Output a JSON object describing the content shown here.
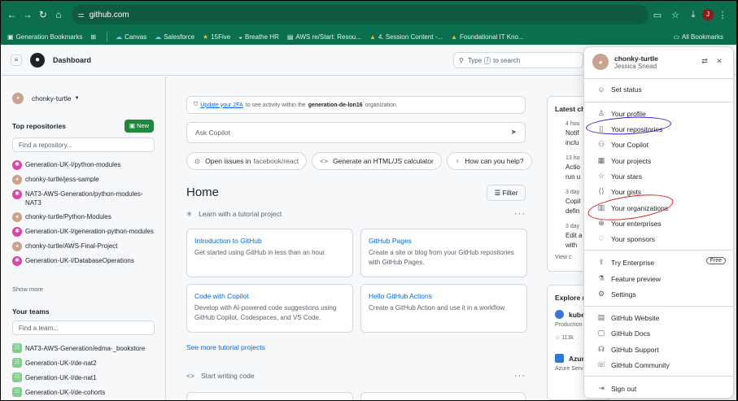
{
  "browser": {
    "url": "github.com",
    "profile_initial": "J",
    "bookmarks": [
      {
        "icon": "▣",
        "label": "Generation Bookmarks"
      },
      {
        "icon": "☁",
        "label": "Canvas"
      },
      {
        "icon": "☁",
        "label": "Salesforce"
      },
      {
        "icon": "★",
        "label": "15Five"
      },
      {
        "icon": "◒",
        "label": "Breathe HR"
      },
      {
        "icon": "▤",
        "label": "AWS re/Start: Resou..."
      },
      {
        "icon": "▲",
        "label": "4. Session Content -..."
      },
      {
        "icon": "▲",
        "label": "Foundational IT Kno..."
      }
    ],
    "all_bookmarks": "All Bookmarks"
  },
  "header": {
    "title": "Dashboard",
    "search_prefix": "Type",
    "search_key": "/",
    "search_suffix": "to search"
  },
  "sidebar": {
    "username": "chonky-turtle",
    "top_repos_title": "Top repositories",
    "new_label": "New",
    "find_repo_placeholder": "Find a repository...",
    "repos": [
      {
        "name": "Generation-UK-I/python-modules",
        "icon": "pink"
      },
      {
        "name": "chonky-turtle/jess-sample",
        "icon": "tan"
      },
      {
        "name": "NAT3-AWS-Generation/python-modules-NAT3",
        "icon": "pink"
      },
      {
        "name": "chonky-turtle/Python-Modules",
        "icon": "tan"
      },
      {
        "name": "Generation-UK-I/generation-python-modules",
        "icon": "pink"
      },
      {
        "name": "chonky-turtle/AWS-Final-Project",
        "icon": "tan"
      },
      {
        "name": "Generation-UK-I/DatabaseOperations",
        "icon": "pink"
      }
    ],
    "show_more": "Show more",
    "teams_title": "Your teams",
    "find_team_placeholder": "Find a team...",
    "teams": [
      "NAT3-AWS-Generation/edma-_bookstore",
      "Generation-UK-I/de-nat2",
      "Generation-UK-I/de-nat1",
      "Generation-UK-I/de-cohorts"
    ]
  },
  "main": {
    "notice_link": "Update your 2FA",
    "notice_text": "to see activity within the",
    "notice_org": "generation-de-lon16",
    "notice_end": "organization.",
    "copilot_placeholder": "Ask Copilot",
    "chips": [
      {
        "icon": "⊙",
        "label": "Open issues in",
        "dim": "facebook/react"
      },
      {
        "icon": "<>",
        "label": "Generate an HTML/JS calculator",
        "dim": ""
      },
      {
        "icon": "♀",
        "label": "How can you help?",
        "dim": ""
      }
    ],
    "home_title": "Home",
    "filter_label": "Filter",
    "tutorial_title": "Learn with a tutorial project",
    "cards": [
      {
        "title": "Introduction to GitHub",
        "desc": "Get started using GitHub in less than an hour."
      },
      {
        "title": "GitHub Pages",
        "desc": "Create a site or blog from your GitHub repositories with GitHub Pages."
      },
      {
        "title": "Code with Copilot",
        "desc": "Develop with AI-powered code suggestions using GitHub Copilot, Codespaces, and VS Code."
      },
      {
        "title": "Hello GitHub Actions",
        "desc": "Create a GitHub Action and use it in a workflow."
      }
    ],
    "see_more": "See more tutorial projects",
    "start_code": "Start writing code"
  },
  "right": {
    "latest_title": "Latest cha",
    "latest_items": [
      {
        "time": "4 hou",
        "lines": [
          "Notif",
          "inclu"
        ]
      },
      {
        "time": "13 ho",
        "lines": [
          "Actio",
          "run u"
        ]
      },
      {
        "time": "3 day",
        "lines": [
          "Copil",
          "defin"
        ]
      },
      {
        "time": "3 day",
        "lines": [
          "Edit a",
          "with"
        ]
      }
    ],
    "view_more": "View c",
    "explore_title": "Explore re",
    "explore_items": [
      {
        "name": "kube",
        "sub": "Production",
        "stars": "113k",
        "color": "#3b73d9"
      },
      {
        "name": "Azure",
        "sub": "Azure Servi",
        "stars": "",
        "color": "#2b7bd3"
      }
    ]
  },
  "menu": {
    "username": "chonky-turtle",
    "full_name": "Jessica Snead",
    "items": [
      {
        "icon": "☺",
        "label": "Set status"
      },
      {
        "icon": "♙",
        "label": "Your profile"
      },
      {
        "icon": "▯",
        "label": "Your repositories"
      },
      {
        "icon": "⚇",
        "label": "Your Copilot"
      },
      {
        "icon": "▦",
        "label": "Your projects"
      },
      {
        "icon": "☆",
        "label": "Your stars"
      },
      {
        "icon": "⟨⟩",
        "label": "Your gists"
      },
      {
        "icon": "▥",
        "label": "Your organizations"
      },
      {
        "icon": "⊕",
        "label": "Your enterprises"
      },
      {
        "icon": "♡",
        "label": "Your sponsors"
      },
      {
        "icon": "⇪",
        "label": "Try Enterprise"
      },
      {
        "icon": "⚗",
        "label": "Feature preview"
      },
      {
        "icon": "⚙",
        "label": "Settings"
      },
      {
        "icon": "▤",
        "label": "GitHub Website"
      },
      {
        "icon": "▢",
        "label": "GitHub Docs"
      },
      {
        "icon": "☊",
        "label": "GitHub Support"
      },
      {
        "icon": "☏",
        "label": "GitHub Community"
      },
      {
        "icon": "⇥",
        "label": "Sign out"
      }
    ],
    "free_badge": "Free"
  }
}
